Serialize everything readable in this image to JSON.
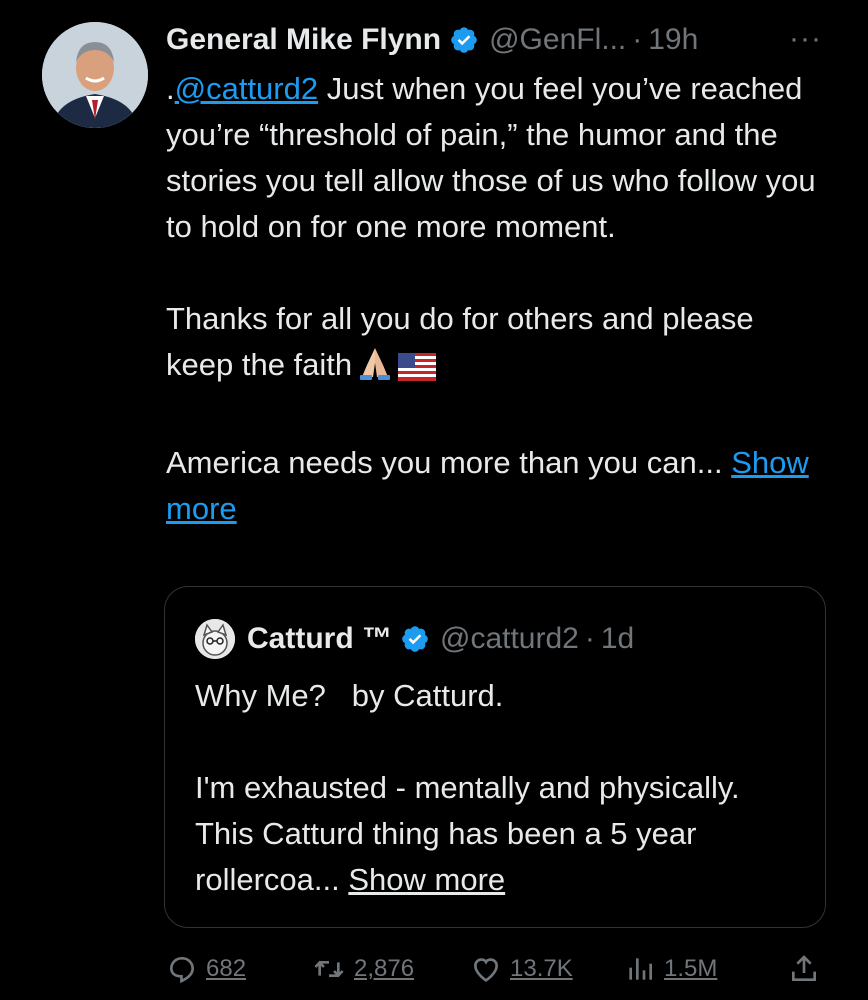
{
  "tweet": {
    "author_name": "General Mike Flynn",
    "handle": "@GenFl...",
    "separator": "·",
    "time": "19h",
    "more_label": "···",
    "mention_prefix": ".",
    "mention": "@catturd2",
    "line1_rest": " Just when you feel you’ve reached you’re “threshold of pain,” the humor and the stories you tell allow those of us who follow you to hold on for one more moment.",
    "para2": "Thanks for all you do for others and please keep the faith",
    "para3": "America needs you more than you can...",
    "show_more": "Show more"
  },
  "quote": {
    "author_name": "Catturd ™",
    "handle": "@catturd2",
    "separator": "·",
    "time": "1d",
    "line1": "Why Me?   by Catturd.",
    "para2": "I'm exhausted - mentally and physically.  This Catturd thing has been a 5 year rollercoa...",
    "show_more": "Show more"
  },
  "actions": {
    "replies": "682",
    "retweets": "2,876",
    "likes": "13.7K",
    "views": "1.5M"
  },
  "colors": {
    "background": "#000000",
    "text": "#e7e9ea",
    "muted": "#71767b",
    "link": "#1d9bf0",
    "verified": "#1d9bf0"
  },
  "icons": [
    "verified-badge-icon",
    "more-icon",
    "reply-icon",
    "retweet-icon",
    "like-icon",
    "views-icon",
    "share-icon",
    "praying-hands-emoji",
    "us-flag-emoji"
  ]
}
